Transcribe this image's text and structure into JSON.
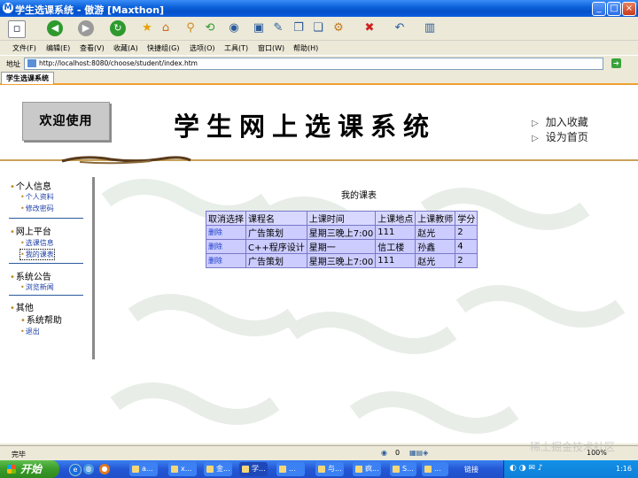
{
  "window": {
    "title": "学生选课系统 - 傲游 [Maxthon]",
    "app_icon": "maxthon-icon",
    "controls": [
      "minimize",
      "maximize",
      "close"
    ]
  },
  "menu": [
    "文件(F)",
    "编辑(E)",
    "查看(V)",
    "收藏(A)",
    "快捷组(G)",
    "选项(O)",
    "工具(T)",
    "窗口(W)",
    "帮助(H)"
  ],
  "address": {
    "label": "地址",
    "url": "http://localhost:8080/choose/student/index.htm"
  },
  "tabs": [
    {
      "label": "学生选课系统",
      "active": true
    }
  ],
  "header": {
    "welcome": "欢迎使用",
    "title": "学生网上选课系统",
    "links": [
      "加入收藏",
      "设为首页"
    ]
  },
  "sidebar": {
    "sections": [
      {
        "title": "个人信息",
        "items": [
          "个人资料",
          "修改密码"
        ]
      },
      {
        "title": "网上平台",
        "items": [
          "选课信息",
          "我的课表"
        ]
      },
      {
        "title": "系统公告",
        "items": [
          "浏览新闻"
        ]
      },
      {
        "title": "其他",
        "items": [
          "系统帮助",
          "退出"
        ]
      }
    ]
  },
  "course_table": {
    "title": "我的课表",
    "headers": [
      "取消选择",
      "课程名",
      "上课时间",
      "上课地点",
      "上课教师",
      "学分"
    ],
    "rows": [
      {
        "action": "删除",
        "course": "广告策划",
        "time": "星期三晚上7:00",
        "place": "111",
        "teacher": "赵光",
        "credit": "2"
      },
      {
        "action": "删除",
        "course": "C++程序设计",
        "time": "星期一",
        "place": "信工楼",
        "teacher": "孙鑫",
        "credit": "4"
      },
      {
        "action": "删除",
        "course": "广告策划",
        "time": "星期三晚上7:00",
        "place": "111",
        "teacher": "赵光",
        "credit": "2"
      }
    ]
  },
  "status": {
    "text": "完毕",
    "count": "0",
    "zoom": "100%"
  },
  "taskbar": {
    "start_label": "开始",
    "tasks": [
      "a...",
      "x...",
      "金...",
      "学...",
      "...",
      "与...",
      "疯...",
      "S...",
      "..."
    ],
    "tray_text": "链接",
    "clock": "1:16"
  },
  "watermark": "稀土掘金技术社区",
  "colors": {
    "titlebar": "#0a5fd8",
    "table_border": "#7878c8",
    "table_cell": "#ccccff",
    "link": "#1a3cc8",
    "tab_accent": "#f0a030"
  }
}
